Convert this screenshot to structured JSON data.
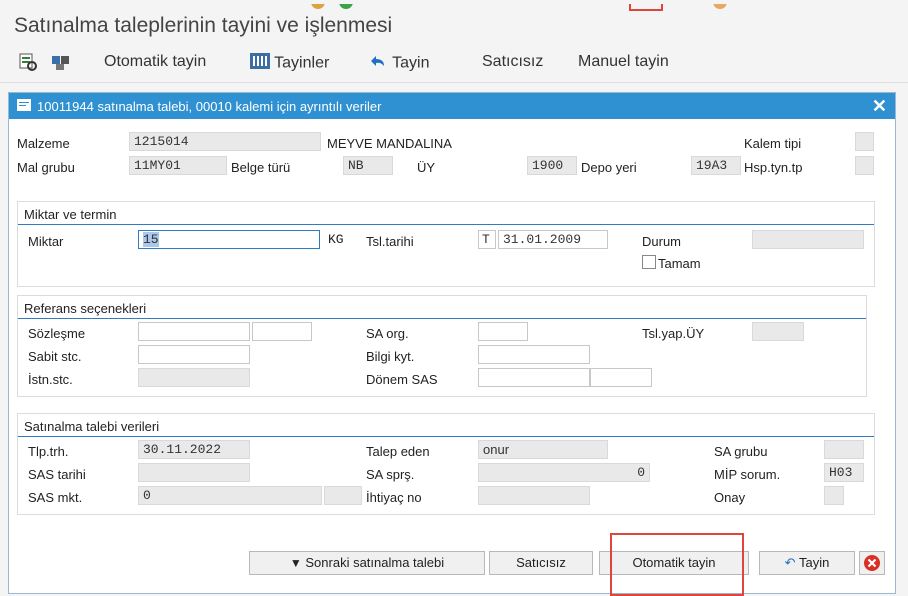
{
  "app": {
    "title": "Satınalma taleplerinin tayini ve işlenmesi"
  },
  "toolbar": {
    "otomatik_tayin": "Otomatik tayin",
    "tayinler": "Tayinler",
    "tayin": "Tayin",
    "saticisiz": "Satıcısız",
    "manuel_tayin": "Manuel tayin"
  },
  "dialog": {
    "title": "10011944 satınalma talebi, 00010 kalemi için ayrıntılı veriler",
    "header": {
      "malzeme_label": "Malzeme",
      "malzeme_value": "1215014",
      "malzeme_desc": "MEYVE MANDALINA",
      "kalem_tipi_label": "Kalem tipi",
      "kalem_tipi_value": "",
      "mal_grubu_label": "Mal grubu",
      "mal_grubu_value": "11MY01",
      "belge_turu_label": "Belge türü",
      "belge_turu_value": "NB",
      "uy_label": "ÜY",
      "uy_value": "1900",
      "depo_yeri_label": "Depo yeri",
      "depo_yeri_value": "19A3",
      "hsp_label": "Hsp.tyn.tp",
      "hsp_value": ""
    },
    "miktar_group": {
      "title": "Miktar ve termin",
      "miktar_label": "Miktar",
      "miktar_value": "15",
      "unit": "KG",
      "tsl_tarihi_label": "Tsl.tarihi",
      "tsl_prefix": "T",
      "tsl_tarihi_value": "31.01.2009",
      "durum_label": "Durum",
      "durum_value": "",
      "tamam_label": "Tamam"
    },
    "referans_group": {
      "title": "Referans seçenekleri",
      "sozlesme_label": "Sözleşme",
      "sabit_stc_label": "Sabit stc.",
      "istn_stc_label": "İstn.stc.",
      "sa_org_label": "SA org.",
      "bilgi_kyt_label": "Bilgi kyt.",
      "donem_sas_label": "Dönem SAS",
      "tsl_yap_uy_label": "Tsl.yap.ÜY"
    },
    "satinalma_group": {
      "title": "Satınalma talebi verileri",
      "tlp_trh_label": "Tlp.trh.",
      "tlp_trh_value": "30.11.2022",
      "sas_tarihi_label": "SAS tarihi",
      "sas_tarihi_value": "",
      "sas_mkt_label": "SAS mkt.",
      "sas_mkt_value": "0",
      "talep_eden_label": "Talep eden",
      "talep_eden_value": "onur",
      "sa_sprs_label": "SA sprş.",
      "sa_sprs_value": "0",
      "ihtiyac_no_label": "İhtiyaç no",
      "ihtiyac_no_value": "",
      "sa_grubu_label": "SA grubu",
      "sa_grubu_value": "",
      "mip_sorum_label": "MİP sorum.",
      "mip_sorum_value": "H03",
      "onay_label": "Onay",
      "onay_value": ""
    },
    "buttons": {
      "sonraki": "Sonraki satınalma talebi",
      "saticisiz": "Satıcısız",
      "otomatik_tayin": "Otomatik tayin",
      "tayin": "Tayin"
    }
  },
  "colors": {
    "accent": "#2f91d1",
    "highlight": "#e0443a"
  }
}
